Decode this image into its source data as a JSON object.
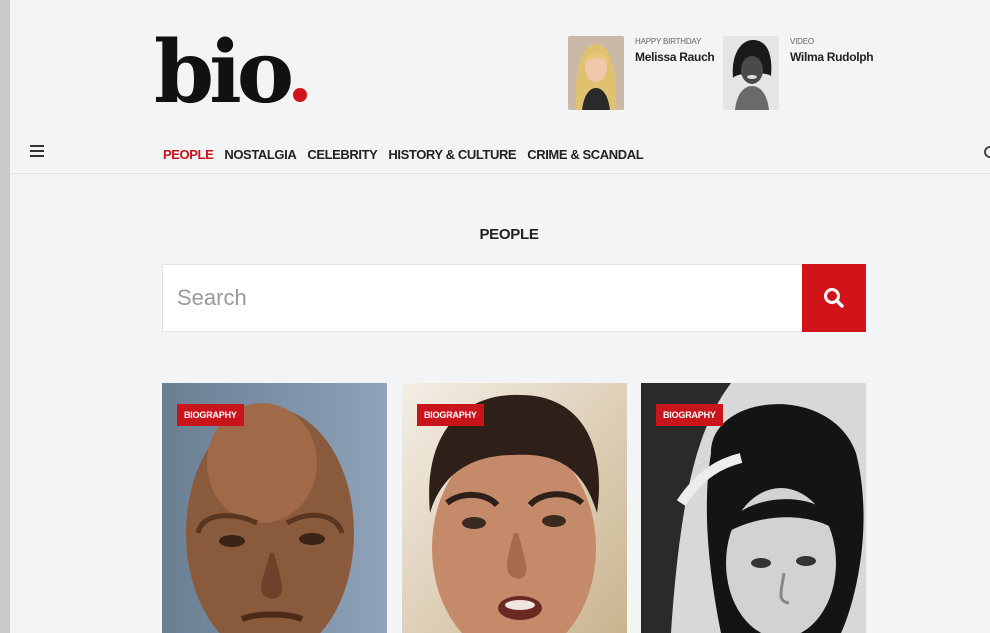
{
  "header": {
    "logo_text": "bio",
    "logo_dot_color": "#d0141a",
    "promos": [
      {
        "kicker": "HAPPY BIRTHDAY",
        "name": "Melissa Rauch"
      },
      {
        "kicker": "VIDEO",
        "name": "Wilma Rudolph"
      }
    ]
  },
  "nav": {
    "menu_icon": "hamburger-icon",
    "items": [
      {
        "label": "PEOPLE",
        "active": true
      },
      {
        "label": "NOSTALGIA"
      },
      {
        "label": "CELEBRITY"
      },
      {
        "label": "HISTORY & CULTURE"
      },
      {
        "label": "CRIME & SCANDAL"
      }
    ],
    "search_icon": "search-icon"
  },
  "main": {
    "section_title": "PEOPLE",
    "search": {
      "placeholder": "Search",
      "value": ""
    },
    "cards": [
      {
        "badge": "BIOGRAPHY"
      },
      {
        "badge": "BIOGRAPHY"
      },
      {
        "badge": "BIOGRAPHY"
      }
    ]
  },
  "colors": {
    "accent": "#c8141b",
    "background": "#f3f4f6"
  }
}
